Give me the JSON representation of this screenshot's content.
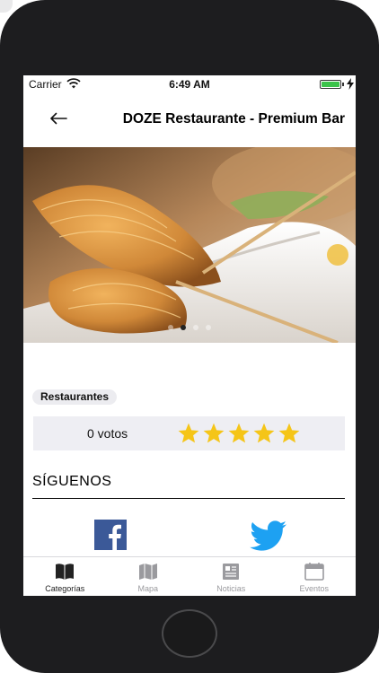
{
  "status_bar": {
    "carrier": "Carrier",
    "time": "6:49 AM",
    "battery_level": 1.0
  },
  "nav": {
    "title": "DOZE Restaurante - Premium Bar",
    "back_icon": "arrow-left-icon"
  },
  "carousel": {
    "slide_count": 4,
    "active_index": 1
  },
  "category_chip": "Restaurantes",
  "rating": {
    "votes_label": "0 votos",
    "stars": 5,
    "star_color": "#f5c518"
  },
  "follow": {
    "heading": "SÍGUENOS",
    "facebook_color": "#3b5998",
    "twitter_color": "#1da1f2"
  },
  "tabs": [
    {
      "label": "Categorías",
      "icon": "book-icon",
      "active": true
    },
    {
      "label": "Mapa",
      "icon": "map-icon",
      "active": false
    },
    {
      "label": "Noticias",
      "icon": "newspaper-icon",
      "active": false
    },
    {
      "label": "Eventos",
      "icon": "calendar-icon",
      "active": false
    }
  ]
}
